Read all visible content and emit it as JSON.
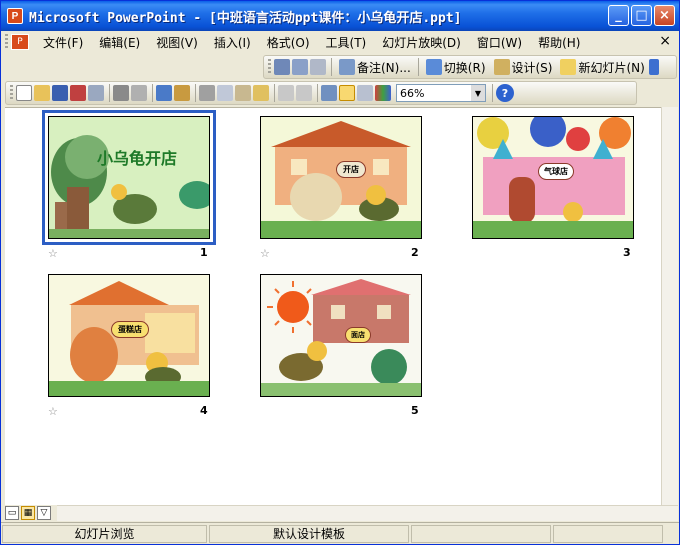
{
  "window": {
    "title": "Microsoft PowerPoint - [中班语言活动ppt课件：小乌龟开店.ppt]",
    "minimize": "_",
    "maximize": "□",
    "close": "×"
  },
  "menubar": {
    "items": [
      {
        "label": "文件(F)"
      },
      {
        "label": "编辑(E)"
      },
      {
        "label": "视图(V)"
      },
      {
        "label": "插入(I)"
      },
      {
        "label": "格式(O)"
      },
      {
        "label": "工具(T)"
      },
      {
        "label": "幻灯片放映(D)"
      },
      {
        "label": "窗口(W)"
      },
      {
        "label": "帮助(H)"
      }
    ],
    "close": "×"
  },
  "toolbar2": {
    "notes_label": "备注(N)...",
    "transition_label": "切换(R)",
    "design_label": "设计(S)",
    "new_slide_label": "新幻灯片(N)"
  },
  "toolbar3": {
    "zoom": "66%"
  },
  "sorter": {
    "slides": [
      {
        "number": "1",
        "title": "小乌龟开店",
        "selected": true
      },
      {
        "number": "2",
        "sign": "开店",
        "selected": false
      },
      {
        "number": "3",
        "sign": "气球店",
        "selected": false
      },
      {
        "number": "4",
        "sign": "蛋糕店",
        "selected": false
      },
      {
        "number": "5",
        "sign": "面店",
        "selected": false
      }
    ],
    "star_icon": "☆"
  },
  "statusbar": {
    "view_name": "幻灯片浏览",
    "template": "默认设计模板"
  },
  "colors": {
    "titlebar": "#0a5fe8",
    "selection": "#2c5ec4",
    "slide_bg": "#cfeab2"
  }
}
